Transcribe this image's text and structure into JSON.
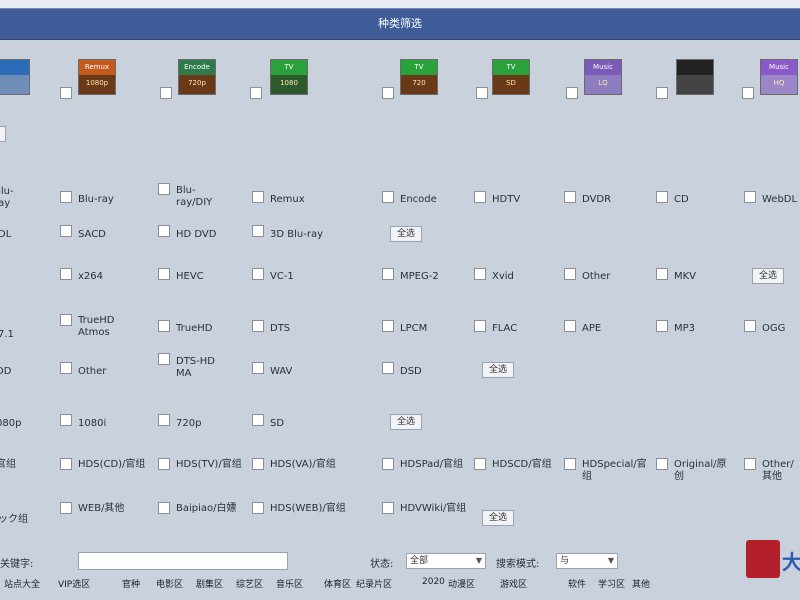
{
  "header": {
    "title": "种类筛选"
  },
  "icons": [
    {
      "name": "blu-ray-icon",
      "top": "",
      "bottom": "",
      "top_color": "#2c6bb8",
      "bottom_color": "#6f8fb8"
    },
    {
      "name": "remux-icon",
      "top": "Remux",
      "bottom": "1080p",
      "top_color": "#c45a1e",
      "bottom_color": "#6a3a18"
    },
    {
      "name": "encode-icon",
      "top": "Encode",
      "bottom": "720p",
      "top_color": "#2f7a4a",
      "bottom_color": "#6a3a18"
    },
    {
      "name": "tv-icon-1",
      "top": "TV",
      "bottom": "1080",
      "top_color": "#2aa13a",
      "bottom_color": "#2d5a2d"
    },
    {
      "name": "tv-icon-2",
      "top": "TV",
      "bottom": "720",
      "top_color": "#2aa13a",
      "bottom_color": "#6a3a18"
    },
    {
      "name": "tv-icon-3",
      "top": "TV",
      "bottom": "SD",
      "top_color": "#2aa13a",
      "bottom_color": "#6a3a18"
    },
    {
      "name": "music-icon",
      "top": "Music",
      "bottom": "LQ",
      "top_color": "#7a5bb8",
      "bottom_color": "#8e7cc0"
    },
    {
      "name": "cd-icon",
      "top": "",
      "bottom": "",
      "top_color": "#222222",
      "bottom_color": "#444444"
    },
    {
      "name": "music-hq-icon",
      "top": "Music",
      "bottom": "HQ",
      "top_color": "#8a5bc8",
      "bottom_color": "#9b86c8"
    }
  ],
  "rows": {
    "medium": {
      "items": [
        "Blu-ray",
        "Blu-ray/DIY",
        "Remux",
        "Encode",
        "HDTV",
        "DVDR",
        "CD",
        "WebDL",
        "SACD",
        "HD DVD",
        "3D Blu-ray"
      ],
      "select_all": "全选"
    },
    "codec": {
      "items": [
        "x264",
        "HEVC",
        "VC-1",
        "MPEG-2",
        "Xvid",
        "Other",
        "MKV"
      ],
      "select_all": "全选"
    },
    "audio": {
      "items": [
        "TrueHD Atmos",
        "TrueHD",
        "DTS",
        "LPCM",
        "FLAC",
        "APE",
        "MP3",
        "OGG",
        "Other",
        "DTS-HD MA",
        "WAV",
        "DSD"
      ],
      "select_all": "全选"
    },
    "resolution": {
      "items": [
        "1080i",
        "720p",
        "SD"
      ],
      "select_all": "全选"
    },
    "team": {
      "items": [
        "HDS(CD)/官组",
        "HDS(TV)/官组",
        "HDS(VA)/官组",
        "HDSPad/官组",
        "HDSCD/官组",
        "HDSpecial/官组",
        "Original/原创",
        "Other/其他",
        "WEB/其他",
        "Baipiao/白嫖",
        "HDS(WEB)/官组",
        "HDVWiki/官组"
      ],
      "select_all": "全选"
    }
  },
  "search": {
    "label": "关键字:",
    "value": "",
    "status_label": "状态:",
    "status_value": "全部",
    "mode_label": "搜索模式:",
    "mode_value": "与"
  },
  "bottom_links": [
    "站点大全",
    "VIP选区",
    "官种",
    "电影区",
    "剧集区",
    "综艺区",
    "音乐区",
    "体育区",
    "纪录片区",
    "2020",
    "动漫区",
    "游戏区",
    "软件",
    "学习区",
    "其他"
  ],
  "logo": {
    "letter": "大"
  }
}
